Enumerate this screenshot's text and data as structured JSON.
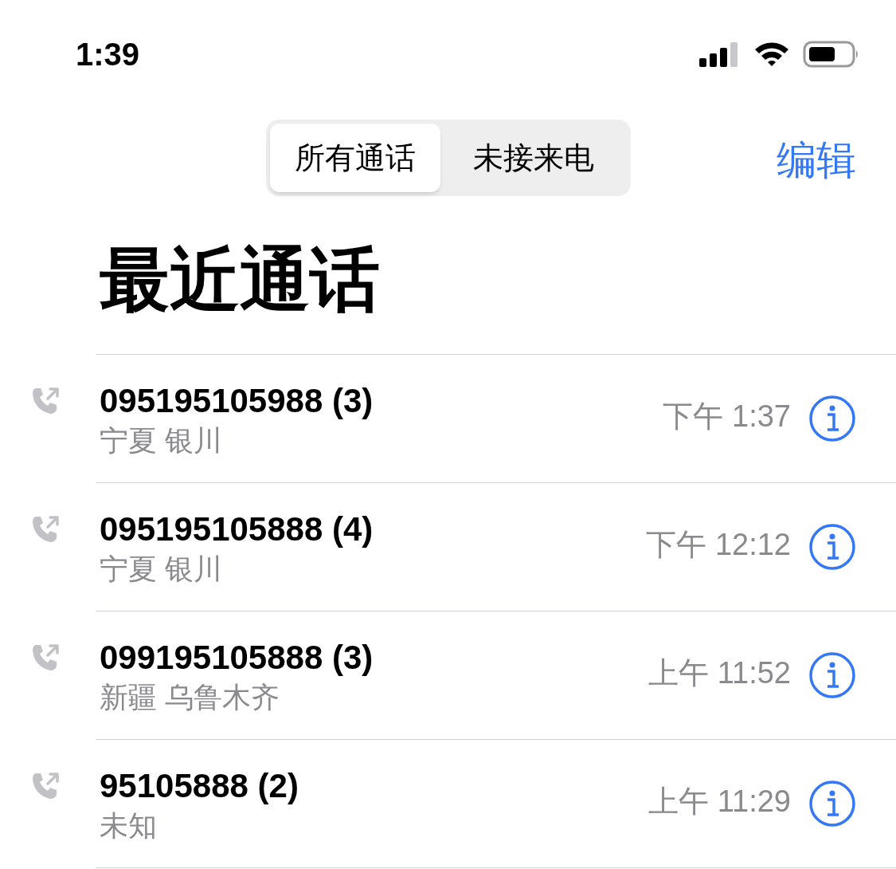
{
  "status_bar": {
    "time": "1:39"
  },
  "tabs": [
    {
      "label": "所有通话",
      "selected": true
    },
    {
      "label": "未接来电",
      "selected": false
    }
  ],
  "edit_button": "编辑",
  "title": "最近通话",
  "calls": [
    {
      "number": "095195105988 (3)",
      "location": "宁夏 银川",
      "time": "下午 1:37"
    },
    {
      "number": "095195105888 (4)",
      "location": "宁夏 银川",
      "time": "下午 12:12"
    },
    {
      "number": "099195105888 (3)",
      "location": "新疆 乌鲁木齐",
      "time": "上午 11:52"
    },
    {
      "number": "95105888 (2)",
      "location": "未知",
      "time": "上午 11:29"
    }
  ]
}
